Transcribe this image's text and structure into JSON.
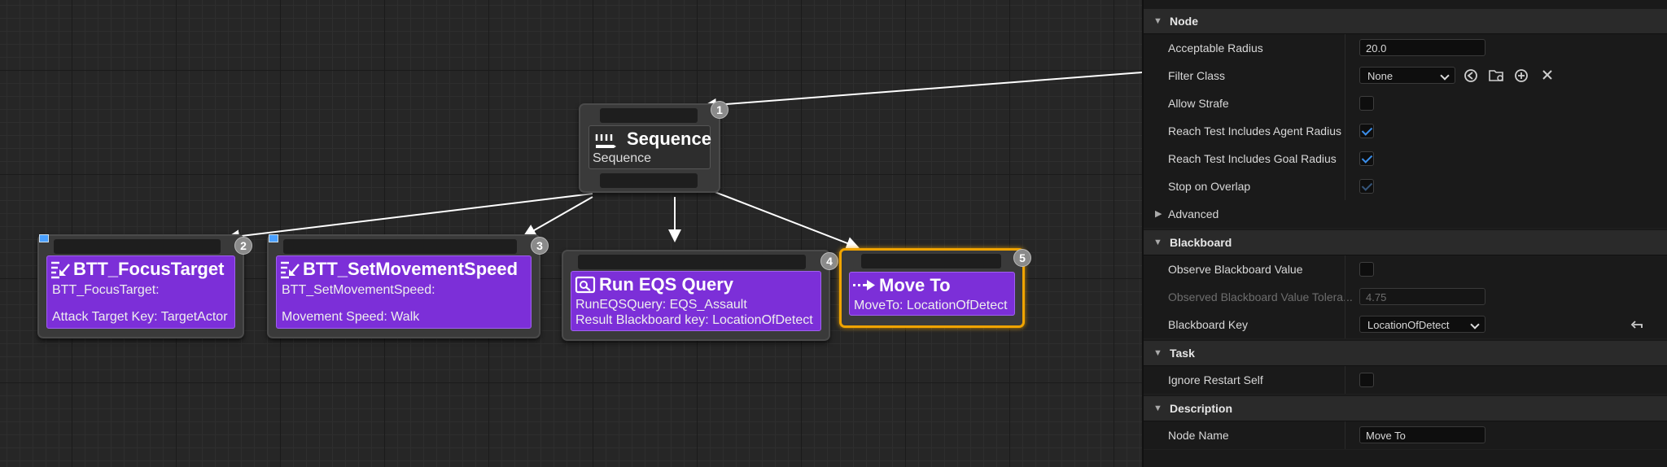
{
  "graph": {
    "nodes": {
      "sequence": {
        "title": "Sequence",
        "subtitle": "Sequence",
        "index": "1"
      },
      "focus": {
        "title": "BTT_FocusTarget",
        "line1": "BTT_FocusTarget:",
        "line2": "Attack Target Key: TargetActor",
        "index": "2"
      },
      "speed": {
        "title": "BTT_SetMovementSpeed",
        "line1": "BTT_SetMovementSpeed:",
        "line2": "Movement Speed: Walk",
        "index": "3"
      },
      "eqs": {
        "title": "Run EQS Query",
        "line1": "RunEQSQuery: EQS_Assault",
        "line2": "Result Blackboard key: LocationOfDetect",
        "index": "4"
      },
      "moveto": {
        "title": "Move To",
        "line1": "MoveTo: LocationOfDetect",
        "index": "5"
      }
    },
    "colors": {
      "task": "#7c2fd8",
      "selected": "#f0a400",
      "composite": "#2d2d2d"
    }
  },
  "details": {
    "sections": {
      "node": "Node",
      "advanced": "Advanced",
      "blackboard": "Blackboard",
      "task": "Task",
      "description": "Description"
    },
    "acceptable_radius": {
      "label": "Acceptable Radius",
      "value": "20.0"
    },
    "filter_class": {
      "label": "Filter Class",
      "value": "None"
    },
    "allow_strafe": {
      "label": "Allow Strafe",
      "checked": false
    },
    "reach_agent": {
      "label": "Reach Test Includes Agent Radius",
      "checked": true
    },
    "reach_goal": {
      "label": "Reach Test Includes Goal Radius",
      "checked": true
    },
    "stop_overlap": {
      "label": "Stop on Overlap",
      "checked": true
    },
    "observe_bb": {
      "label": "Observe Blackboard Value",
      "checked": false
    },
    "observed_tol": {
      "label": "Observed Blackboard Value Tolera...",
      "value": "4.75"
    },
    "bb_key": {
      "label": "Blackboard Key",
      "value": "LocationOfDetect"
    },
    "ignore_restart": {
      "label": "Ignore Restart Self",
      "checked": false
    },
    "node_name": {
      "label": "Node Name",
      "value": "Move To"
    },
    "icons": [
      "browse-back-icon",
      "browse-folder-icon",
      "add-icon",
      "clear-icon",
      "reset-arrow-icon"
    ]
  }
}
